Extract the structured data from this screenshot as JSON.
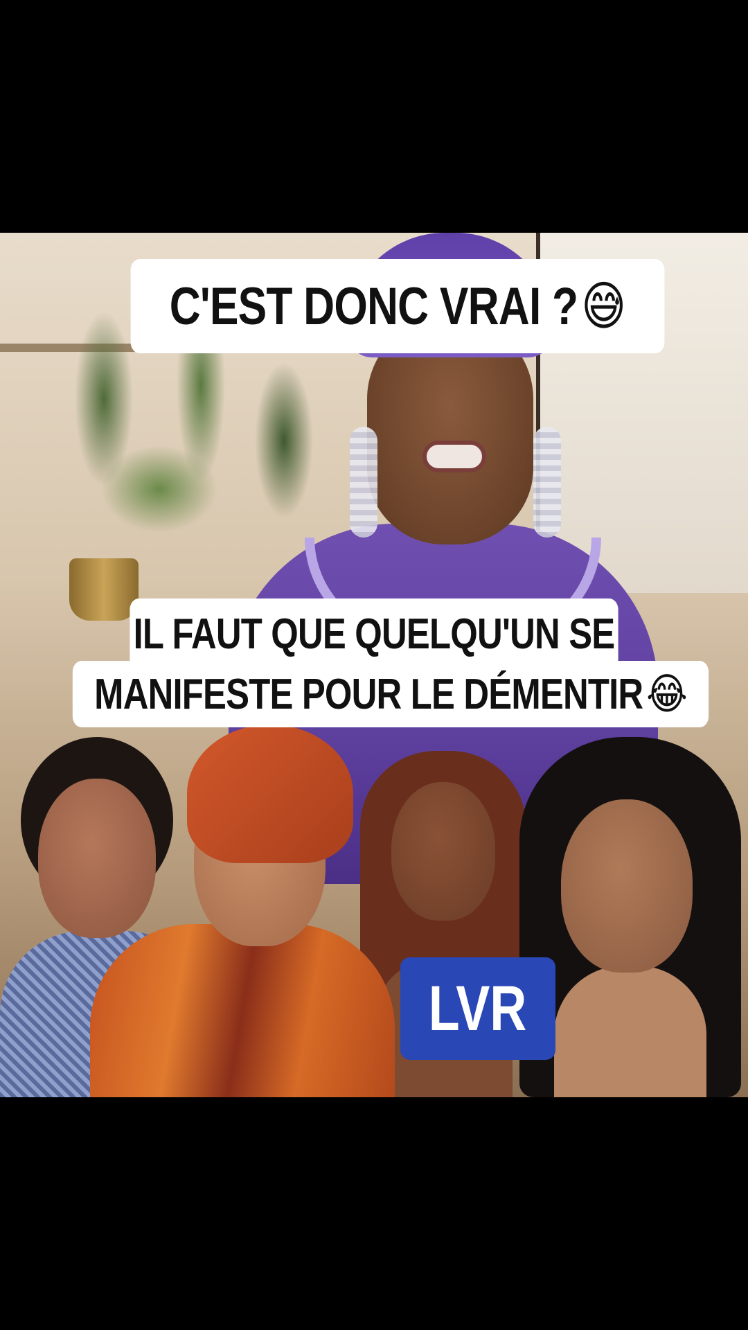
{
  "caption_top": {
    "text": "C'EST DONC VRAI ?",
    "emoji": "😅"
  },
  "caption_bottom": {
    "line1": "IL FAUT QUE QUELQU'UN SE",
    "line2": "MANIFESTE POUR LE DÉMENTIR",
    "emoji": "😂"
  },
  "logo": {
    "text": "LVR",
    "color": "#2a47b6"
  },
  "colors": {
    "background": "#000000",
    "caption_bg": "#ffffff",
    "caption_text": "#111111"
  }
}
